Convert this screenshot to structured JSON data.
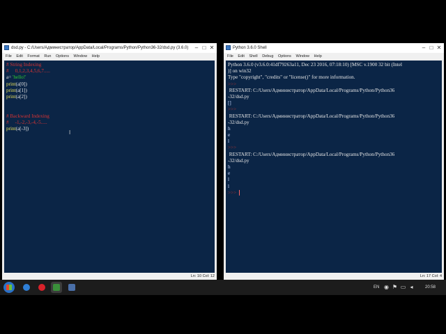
{
  "editor": {
    "title": "dsd.py - C:/Users/Администратор/AppData/Local/Programs/Python/Python36-32/dsd.py (3.6.0)",
    "menu": [
      "File",
      "Edit",
      "Format",
      "Run",
      "Options",
      "Window",
      "Help"
    ],
    "lines": [
      {
        "segments": [
          {
            "t": "# String Indexing",
            "c": "comment"
          }
        ]
      },
      {
        "segments": [
          {
            "t": "#     0,1,2,3,4,5,6,7.....",
            "c": "comment"
          }
        ]
      },
      {
        "segments": [
          {
            "t": "a= ",
            "c": "def"
          },
          {
            "t": "'hello!'",
            "c": "str"
          }
        ]
      },
      {
        "segments": [
          {
            "t": "print",
            "c": "fn"
          },
          {
            "t": "(a[0])",
            "c": "def"
          }
        ]
      },
      {
        "segments": [
          {
            "t": "print",
            "c": "fn"
          },
          {
            "t": "(a[1])",
            "c": "def"
          }
        ]
      },
      {
        "segments": [
          {
            "t": "print",
            "c": "fn"
          },
          {
            "t": "(a[2])",
            "c": "def"
          }
        ]
      },
      {
        "segments": []
      },
      {
        "segments": []
      },
      {
        "segments": [
          {
            "t": "# Backward Indexing",
            "c": "comment"
          }
        ]
      },
      {
        "segments": [
          {
            "t": "#     -1,-2,-3,-4,-5.....",
            "c": "comment"
          }
        ]
      },
      {
        "segments": [
          {
            "t": "print",
            "c": "fn"
          },
          {
            "t": "(a[-3])",
            "c": "def"
          }
        ]
      }
    ],
    "status": "Ln: 10   Col: 12"
  },
  "shell": {
    "title": "Python 3.6.0 Shell",
    "menu": [
      "File",
      "Edit",
      "Shell",
      "Debug",
      "Options",
      "Window",
      "Help"
    ],
    "lines": [
      {
        "segments": [
          {
            "t": "Python 3.6.0 (v3.6.0:41df79263a11, Dec 23 2016, 07:18:10) [MSC v.1900 32 bit (Intel",
            "c": "def"
          }
        ]
      },
      {
        "segments": [
          {
            "t": ")] on win32",
            "c": "def"
          }
        ]
      },
      {
        "segments": [
          {
            "t": "Type \"copyright\", \"credits\" or \"license()\" for more information.",
            "c": "def"
          }
        ]
      },
      {
        "segments": [
          {
            "t": ">>> ",
            "c": "prompt"
          }
        ]
      },
      {
        "segments": [
          {
            "t": " RESTART: C:/Users/Администратор/AppData/Local/Programs/Python/Python36",
            "c": "def"
          }
        ]
      },
      {
        "segments": [
          {
            "t": "-32/dsd.py ",
            "c": "def"
          }
        ]
      },
      {
        "segments": [
          {
            "t": "[]",
            "c": "out"
          }
        ]
      },
      {
        "segments": [
          {
            "t": ">>> ",
            "c": "prompt"
          }
        ]
      },
      {
        "segments": [
          {
            "t": " RESTART: C:/Users/Администратор/AppData/Local/Programs/Python/Python36",
            "c": "def"
          }
        ]
      },
      {
        "segments": [
          {
            "t": "-32/dsd.py ",
            "c": "def"
          }
        ]
      },
      {
        "segments": [
          {
            "t": "h",
            "c": "out"
          }
        ]
      },
      {
        "segments": [
          {
            "t": "e",
            "c": "out"
          }
        ]
      },
      {
        "segments": [
          {
            "t": "l",
            "c": "out"
          }
        ]
      },
      {
        "segments": [
          {
            "t": ">>> ",
            "c": "prompt"
          }
        ]
      },
      {
        "segments": [
          {
            "t": " RESTART: C:/Users/Администратор/AppData/Local/Programs/Python/Python36",
            "c": "def"
          }
        ]
      },
      {
        "segments": [
          {
            "t": "-32/dsd.py ",
            "c": "def"
          }
        ]
      },
      {
        "segments": [
          {
            "t": "h",
            "c": "out"
          }
        ]
      },
      {
        "segments": [
          {
            "t": "e",
            "c": "out"
          }
        ]
      },
      {
        "segments": [
          {
            "t": "l",
            "c": "out"
          }
        ]
      },
      {
        "segments": [
          {
            "t": "l",
            "c": "out"
          }
        ]
      },
      {
        "segments": [
          {
            "t": ">>> ",
            "c": "prompt"
          }
        ],
        "caret": true
      }
    ],
    "status": "Ln: 17   Col: 4"
  },
  "window_controls": {
    "minimize": "–",
    "maximize": "□",
    "close": "✕"
  },
  "taskbar": {
    "apps": [
      {
        "name": "ie-icon",
        "color": "#2f7fd6"
      },
      {
        "name": "opera-icon",
        "color": "#d9222a"
      },
      {
        "name": "python-idle-icon",
        "color": "#3a8f3a"
      },
      {
        "name": "monitor-app-icon",
        "color": "#4a6fa8"
      }
    ],
    "language": "EN",
    "time": "20:58"
  },
  "colors": {
    "editor_bg": "#0b2546",
    "comment": "#d83333",
    "string": "#2fcf2f",
    "builtin": "#e8e05a",
    "text": "#e6e6e6"
  }
}
